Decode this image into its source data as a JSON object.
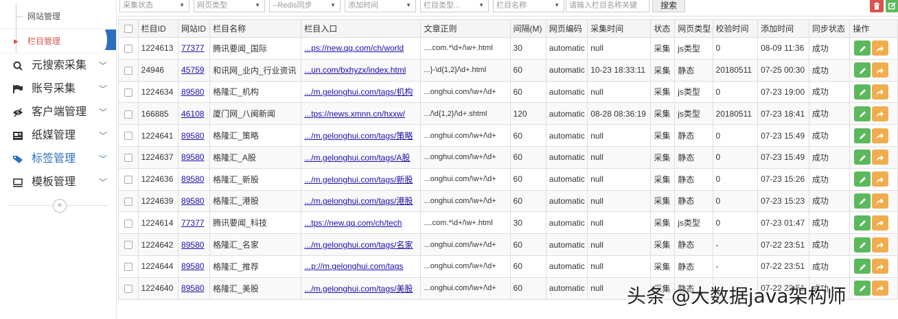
{
  "sidebar": {
    "sub_items": [
      {
        "label": "网站管理",
        "active": false
      },
      {
        "label": "栏目管理",
        "active": true
      }
    ],
    "nav_items": [
      {
        "label": "元搜索采集",
        "icon": "search-icon"
      },
      {
        "label": "账号采集",
        "icon": "flag-icon"
      },
      {
        "label": "客户端管理",
        "icon": "eye-slash-icon"
      },
      {
        "label": "纸媒管理",
        "icon": "newspaper-icon"
      },
      {
        "label": "标签管理",
        "icon": "tag-icon",
        "active": true
      },
      {
        "label": "模板管理",
        "icon": "monitor-icon"
      }
    ],
    "collapse_symbol": "«"
  },
  "filters": {
    "collect_status": "采集状态",
    "page_type": "网页类型",
    "redis_sync": "--Redis同步",
    "add_time": "添加时间",
    "column_type": "栏目类型...",
    "column_name": "栏目名称",
    "search_placeholder": "请输入栏目名称关键",
    "search_button": "搜索"
  },
  "table": {
    "headers": [
      "栏目ID",
      "网站ID",
      "栏目名称",
      "栏目入口",
      "文章正则",
      "间隔(M)",
      "网页编码",
      "采集时间",
      "状态",
      "网页类型",
      "校验时间",
      "添加时间",
      "同步状态",
      "操作"
    ],
    "rows": [
      {
        "col_id": "1224613",
        "site_id": "77377",
        "name": "腾讯要闻_国际",
        "entry": "...ps://new.qq.com/ch/world",
        "regex": "....com.*\\d+/\\w+.html",
        "interval": "30",
        "encoding": "automatic",
        "collect_time": "null",
        "status": "采集",
        "page_type": "js类型",
        "check_time": "0",
        "add_time": "08-09 11:36",
        "sync": "成功"
      },
      {
        "col_id": "24946",
        "site_id": "45759",
        "name": "和讯网_业内_行业资讯",
        "entry": "...un.com/bxhyzx/index.html",
        "regex": "...}-\\d{1,2}/\\d+.html",
        "interval": "60",
        "encoding": "automatic",
        "collect_time": "10-23 18:33:11",
        "status": "采集",
        "page_type": "静态",
        "check_time": "20180511",
        "add_time": "07-25 00:30",
        "sync": "成功"
      },
      {
        "col_id": "1224634",
        "site_id": "89580",
        "name": "格隆汇_机构",
        "entry": ".../m.gelonghui.com/tags/机构",
        "regex": "...onghui.com/\\w+/\\d+",
        "interval": "60",
        "encoding": "automatic",
        "collect_time": "null",
        "status": "采集",
        "page_type": "js类型",
        "check_time": "0",
        "add_time": "07-23 19:00",
        "sync": "成功"
      },
      {
        "col_id": "166885",
        "site_id": "46108",
        "name": "厦门网_八闽新闻",
        "entry": "...tps://news.xmnn.cn/hxxw/",
        "regex": ".../\\d{1,2}/\\d+.shtml",
        "interval": "120",
        "encoding": "automatic",
        "collect_time": "08-28 08:36:19",
        "status": "采集",
        "page_type": "js类型",
        "check_time": "20180511",
        "add_time": "07-23 18:41",
        "sync": "成功"
      },
      {
        "col_id": "1224641",
        "site_id": "89580",
        "name": "格隆汇_策略",
        "entry": ".../m.gelonghui.com/tags/策略",
        "regex": "...onghui.com/\\w+/\\d+",
        "interval": "60",
        "encoding": "automatic",
        "collect_time": "null",
        "status": "采集",
        "page_type": "静态",
        "check_time": "0",
        "add_time": "07-23 15:49",
        "sync": "成功"
      },
      {
        "col_id": "1224637",
        "site_id": "89580",
        "name": "格隆汇_A股",
        "entry": ".../m.gelonghui.com/tags/A股",
        "regex": "...onghui.com/\\w+/\\d+",
        "interval": "60",
        "encoding": "automatic",
        "collect_time": "null",
        "status": "采集",
        "page_type": "静态",
        "check_time": "0",
        "add_time": "07-23 15:49",
        "sync": "成功"
      },
      {
        "col_id": "1224636",
        "site_id": "89580",
        "name": "格隆汇_新股",
        "entry": ".../m.gelonghui.com/tags/新股",
        "regex": "...onghui.com/\\w+/\\d+",
        "interval": "60",
        "encoding": "automatic",
        "collect_time": "null",
        "status": "采集",
        "page_type": "静态",
        "check_time": "0",
        "add_time": "07-23 15:26",
        "sync": "成功"
      },
      {
        "col_id": "1224639",
        "site_id": "89580",
        "name": "格隆汇_港股",
        "entry": ".../m.gelonghui.com/tags/港股",
        "regex": "...onghui.com/\\w+/\\d+",
        "interval": "60",
        "encoding": "automatic",
        "collect_time": "null",
        "status": "采集",
        "page_type": "静态",
        "check_time": "0",
        "add_time": "07-23 15:23",
        "sync": "成功"
      },
      {
        "col_id": "1224614",
        "site_id": "77377",
        "name": "腾讯要闻_科技",
        "entry": "...tps://new.qq.com/ch/tech",
        "regex": "....com.*\\d+/\\w+.html",
        "interval": "30",
        "encoding": "automatic",
        "collect_time": "null",
        "status": "采集",
        "page_type": "js类型",
        "check_time": "0",
        "add_time": "07-23 01:47",
        "sync": "成功"
      },
      {
        "col_id": "1224642",
        "site_id": "89580",
        "name": "格隆汇_名家",
        "entry": ".../m.gelonghui.com/tags/名家",
        "regex": "...onghui.com/\\w+/\\d+",
        "interval": "60",
        "encoding": "automatic",
        "collect_time": "null",
        "status": "采集",
        "page_type": "静态",
        "check_time": "-",
        "add_time": "07-22 23:51",
        "sync": "成功"
      },
      {
        "col_id": "1224644",
        "site_id": "89580",
        "name": "格隆汇_推荐",
        "entry": "...p://m.gelonghui.com/tags",
        "regex": "...onghui.com/\\w+/\\d+",
        "interval": "60",
        "encoding": "automatic",
        "collect_time": "null",
        "status": "采集",
        "page_type": "静态",
        "check_time": "-",
        "add_time": "07-22 23:51",
        "sync": "成功"
      },
      {
        "col_id": "1224640",
        "site_id": "89580",
        "name": "格隆汇_美股",
        "entry": ".../m.gelonghui.com/tags/美股",
        "regex": "...onghui.com/\\w+/\\d+",
        "interval": "60",
        "encoding": "automatic",
        "collect_time": "null",
        "status": "采集",
        "page_type": "静态",
        "check_time": "-",
        "add_time": "07-22 23:51",
        "sync": "成功"
      }
    ]
  },
  "watermark": "头条 @大数据java架构师",
  "colors": {
    "active_red": "#d9534f",
    "active_blue": "#2a6fbf",
    "edit_green": "#5cb85c",
    "go_orange": "#f0ad4e"
  }
}
